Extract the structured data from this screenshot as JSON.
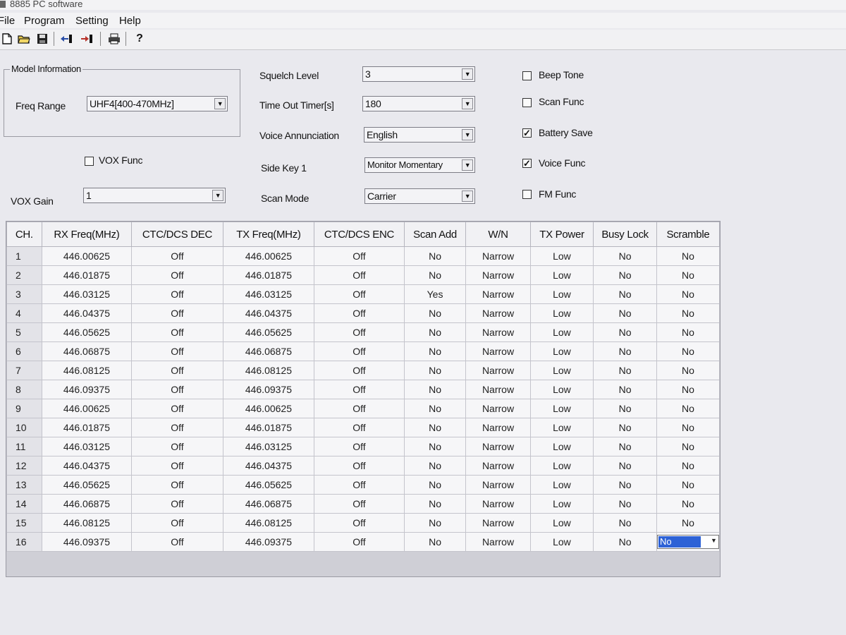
{
  "window": {
    "title": "8885 PC software"
  },
  "menu": [
    "File",
    "Program",
    "Setting",
    "Help"
  ],
  "toolbar": {
    "icons": [
      "new-file-icon",
      "open-folder-icon",
      "save-icon",
      "read-from-radio-icon",
      "write-to-radio-icon",
      "print-icon",
      "help-icon"
    ]
  },
  "model_info": {
    "legend": "Model Information",
    "freq_range_label": "Freq Range",
    "freq_range_value": "UHF4[400-470MHz]"
  },
  "vox": {
    "vox_func_label": "VOX Func",
    "vox_func_checked": false,
    "vox_gain_label": "VOX Gain",
    "vox_gain_value": "1"
  },
  "settings": {
    "squelch_label": "Squelch Level",
    "squelch_value": "3",
    "tot_label": "Time Out Timer[s]",
    "tot_value": "180",
    "voice_label": "Voice Annunciation",
    "voice_value": "English",
    "sidekey_label": "Side Key 1",
    "sidekey_value": "Monitor Momentary",
    "scanmode_label": "Scan Mode",
    "scanmode_value": "Carrier"
  },
  "checks": [
    {
      "label": "Beep Tone",
      "checked": false
    },
    {
      "label": "Scan Func",
      "checked": false
    },
    {
      "label": "Battery Save",
      "checked": true
    },
    {
      "label": "Voice Func",
      "checked": true
    },
    {
      "label": "FM Func",
      "checked": false
    }
  ],
  "table": {
    "columns": [
      "CH.",
      "RX Freq(MHz)",
      "CTC/DCS DEC",
      "TX Freq(MHz)",
      "CTC/DCS ENC",
      "Scan Add",
      "W/N",
      "TX Power",
      "Busy Lock",
      "Scramble"
    ],
    "rows": [
      [
        "1",
        "446.00625",
        "Off",
        "446.00625",
        "Off",
        "No",
        "Narrow",
        "Low",
        "No",
        "No"
      ],
      [
        "2",
        "446.01875",
        "Off",
        "446.01875",
        "Off",
        "No",
        "Narrow",
        "Low",
        "No",
        "No"
      ],
      [
        "3",
        "446.03125",
        "Off",
        "446.03125",
        "Off",
        "Yes",
        "Narrow",
        "Low",
        "No",
        "No"
      ],
      [
        "4",
        "446.04375",
        "Off",
        "446.04375",
        "Off",
        "No",
        "Narrow",
        "Low",
        "No",
        "No"
      ],
      [
        "5",
        "446.05625",
        "Off",
        "446.05625",
        "Off",
        "No",
        "Narrow",
        "Low",
        "No",
        "No"
      ],
      [
        "6",
        "446.06875",
        "Off",
        "446.06875",
        "Off",
        "No",
        "Narrow",
        "Low",
        "No",
        "No"
      ],
      [
        "7",
        "446.08125",
        "Off",
        "446.08125",
        "Off",
        "No",
        "Narrow",
        "Low",
        "No",
        "No"
      ],
      [
        "8",
        "446.09375",
        "Off",
        "446.09375",
        "Off",
        "No",
        "Narrow",
        "Low",
        "No",
        "No"
      ],
      [
        "9",
        "446.00625",
        "Off",
        "446.00625",
        "Off",
        "No",
        "Narrow",
        "Low",
        "No",
        "No"
      ],
      [
        "10",
        "446.01875",
        "Off",
        "446.01875",
        "Off",
        "No",
        "Narrow",
        "Low",
        "No",
        "No"
      ],
      [
        "11",
        "446.03125",
        "Off",
        "446.03125",
        "Off",
        "No",
        "Narrow",
        "Low",
        "No",
        "No"
      ],
      [
        "12",
        "446.04375",
        "Off",
        "446.04375",
        "Off",
        "No",
        "Narrow",
        "Low",
        "No",
        "No"
      ],
      [
        "13",
        "446.05625",
        "Off",
        "446.05625",
        "Off",
        "No",
        "Narrow",
        "Low",
        "No",
        "No"
      ],
      [
        "14",
        "446.06875",
        "Off",
        "446.06875",
        "Off",
        "No",
        "Narrow",
        "Low",
        "No",
        "No"
      ],
      [
        "15",
        "446.08125",
        "Off",
        "446.08125",
        "Off",
        "No",
        "Narrow",
        "Low",
        "No",
        "No"
      ],
      [
        "16",
        "446.09375",
        "Off",
        "446.09375",
        "Off",
        "No",
        "Narrow",
        "Low",
        "No",
        "No"
      ]
    ]
  },
  "colors": {
    "selection": "#2d62d6",
    "window_bg": "#e9e9ee",
    "grid_bg": "#cfcfd6"
  }
}
